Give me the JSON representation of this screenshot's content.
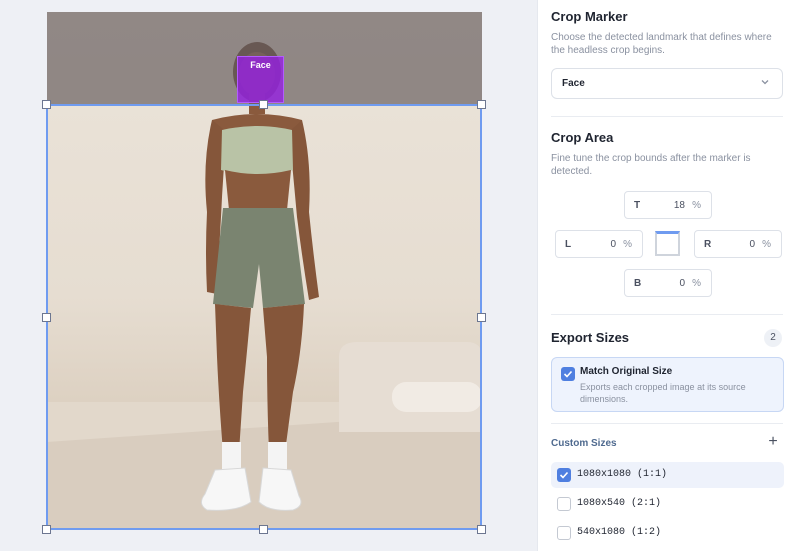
{
  "preview": {
    "marker_label": "Face"
  },
  "crop_marker": {
    "title": "Crop Marker",
    "description": "Choose the detected landmark that defines where the headless crop begins.",
    "selected": "Face"
  },
  "crop_area": {
    "title": "Crop Area",
    "description": "Fine tune the crop bounds after the marker is detected.",
    "top": {
      "key": "T",
      "value": "18",
      "unit": "%"
    },
    "left": {
      "key": "L",
      "value": "0",
      "unit": "%"
    },
    "right": {
      "key": "R",
      "value": "0",
      "unit": "%"
    },
    "bottom": {
      "key": "B",
      "value": "0",
      "unit": "%"
    }
  },
  "export_sizes": {
    "title": "Export Sizes",
    "count": "2",
    "match_original": {
      "title": "Match Original Size",
      "description": "Exports each cropped image at its source dimensions.",
      "checked": true
    },
    "custom_title": "Custom Sizes",
    "add_label": "+",
    "sizes": [
      {
        "label": "1080x1080 (1:1)",
        "checked": true
      },
      {
        "label": "1080x540 (2:1)",
        "checked": false
      },
      {
        "label": "540x1080 (1:2)",
        "checked": false
      }
    ]
  },
  "colors": {
    "accent": "#4f7fe0",
    "crop_border": "#6f9bf0",
    "marker": "#9b1ee6"
  }
}
